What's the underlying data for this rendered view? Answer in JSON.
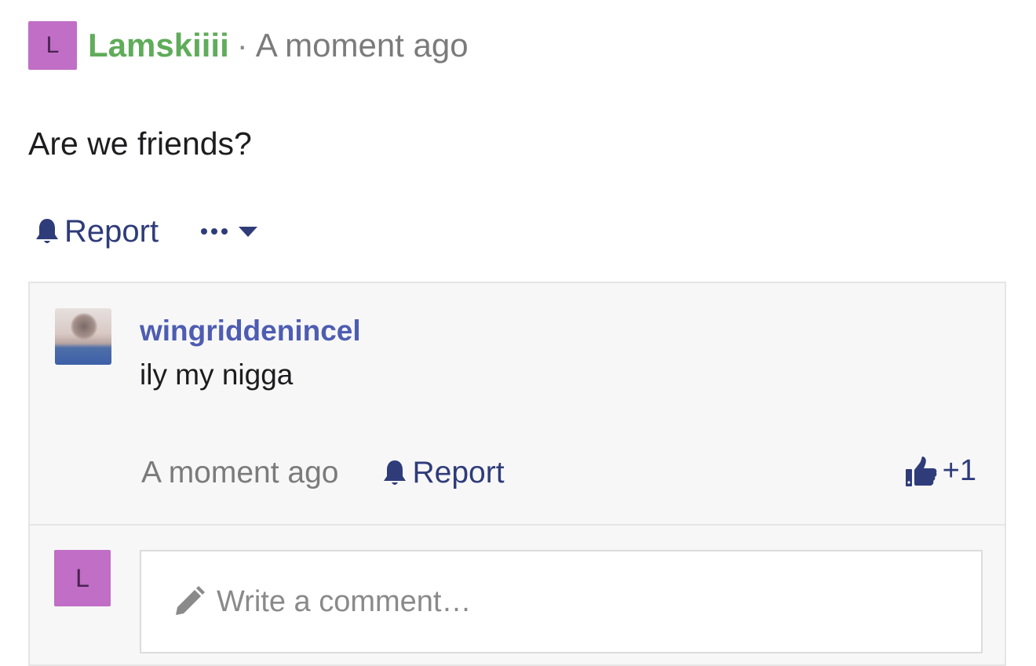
{
  "post": {
    "author_initial": "L",
    "author_name": "Lamskiiii",
    "separator": "·",
    "time": "A moment ago",
    "body": "Are we friends?",
    "actions": {
      "report_label": "Report",
      "report_icon": "bell-icon",
      "more_icon": "more-options-icon"
    }
  },
  "comment": {
    "author": "wingriddenincel",
    "text": "ily my nigga",
    "time": "A moment ago",
    "report_label": "Report",
    "like_icon": "thumbs-up-icon",
    "like_count": "+1"
  },
  "reply": {
    "avatar_initial": "L",
    "placeholder": "Write a comment…",
    "icon": "pencil-icon"
  },
  "colors": {
    "author_green": "#5fac5a",
    "link_navy": "#2f3c7a",
    "commenter_blue": "#4e5db1",
    "avatar_purple": "#c06ec6",
    "panel_bg": "#f7f7f7"
  }
}
